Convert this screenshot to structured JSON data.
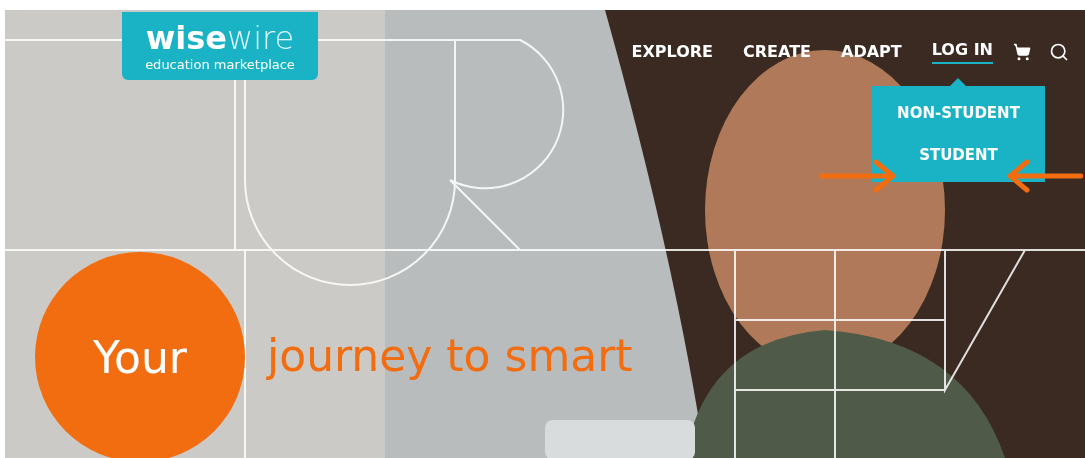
{
  "logo": {
    "name": "**wise**wire",
    "tagline": "education marketplace"
  },
  "nav": {
    "items": [
      {
        "label": "EXPLORE",
        "selected": false
      },
      {
        "label": "CREATE",
        "selected": false
      },
      {
        "label": "ADAPT",
        "selected": false
      },
      {
        "label": "LOG IN",
        "selected": true
      }
    ]
  },
  "login_menu": {
    "items": [
      {
        "label": "NON-STUDENT",
        "annotated": false
      },
      {
        "label": "STUDENT",
        "annotated": true
      }
    ]
  },
  "hero": {
    "badge": "Your",
    "headline": "journey to smart"
  }
}
